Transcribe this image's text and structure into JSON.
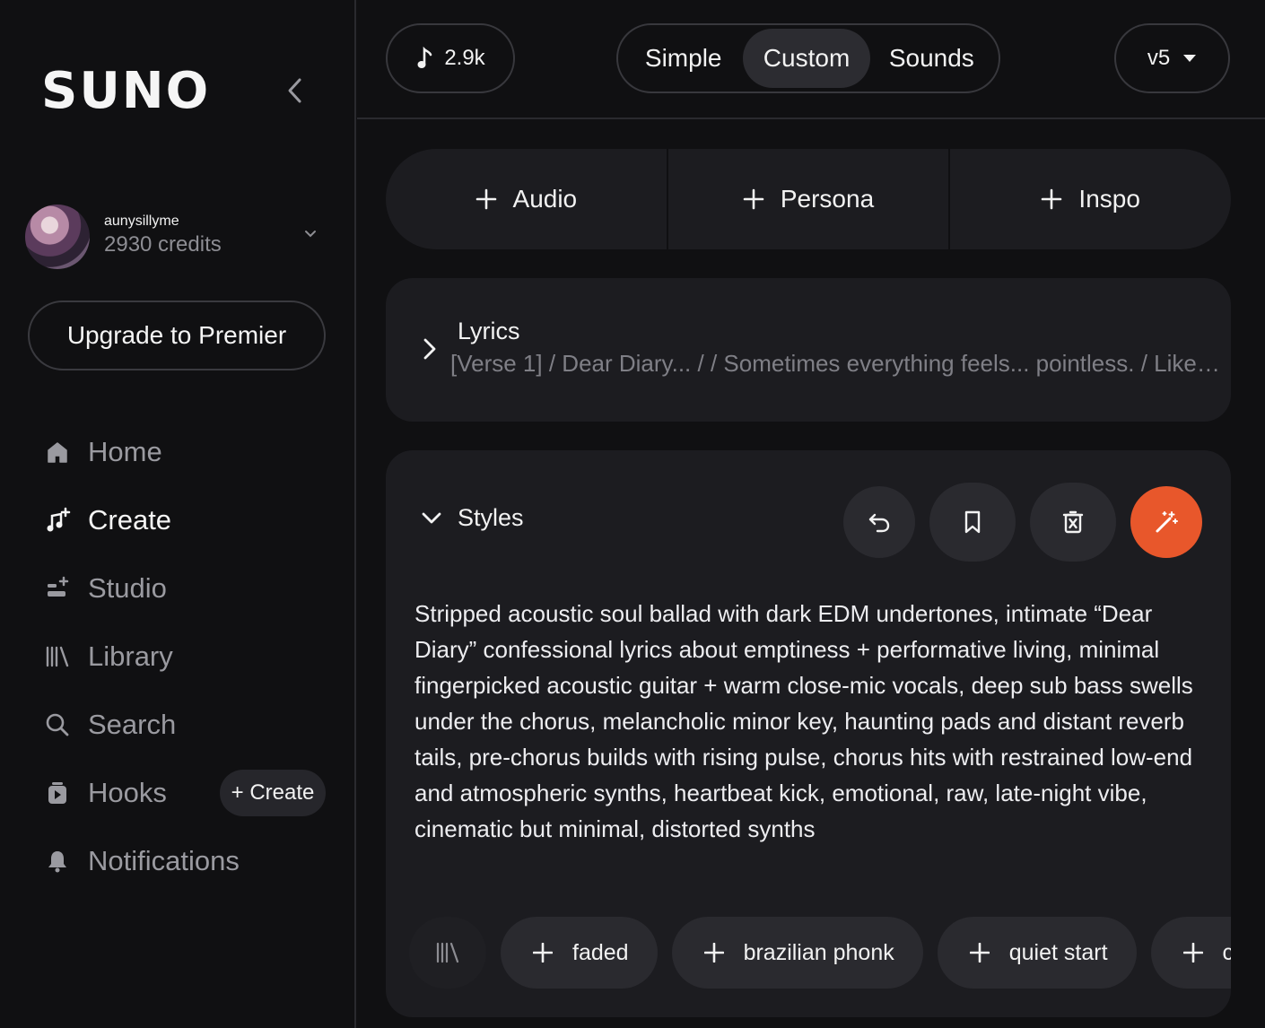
{
  "sidebar": {
    "logo": "SUNO",
    "user": {
      "name": "aunysillyme",
      "credits": "2930 credits"
    },
    "upgrade_label": "Upgrade to Premier",
    "nav": [
      {
        "label": "Home",
        "icon": "home-icon",
        "active": false
      },
      {
        "label": "Create",
        "icon": "create-music-icon",
        "active": true
      },
      {
        "label": "Studio",
        "icon": "studio-icon",
        "active": false
      },
      {
        "label": "Library",
        "icon": "library-icon",
        "active": false
      },
      {
        "label": "Search",
        "icon": "search-icon",
        "active": false
      },
      {
        "label": "Hooks",
        "icon": "hooks-icon",
        "active": false
      },
      {
        "label": "Notifications",
        "icon": "bell-icon",
        "active": false
      }
    ],
    "hooks_create_label": "+ Create"
  },
  "topbar": {
    "credits_label": "2.9k",
    "modes": [
      "Simple",
      "Custom",
      "Sounds"
    ],
    "active_mode": "Custom",
    "version": "v5"
  },
  "add_buttons": [
    "Audio",
    "Persona",
    "Inspo"
  ],
  "lyrics": {
    "title": "Lyrics",
    "preview": "[Verse 1] / Dear Diary... / / Sometimes everything feels... pointless. / Like t..."
  },
  "styles": {
    "title": "Styles",
    "text": "Stripped acoustic soul ballad with dark EDM undertones, intimate “Dear Diary” confessional lyrics about emptiness + performative living, minimal fingerpicked acoustic guitar + warm close-mic vocals, deep sub bass swells under the chorus, melancholic minor key, haunting pads and distant reverb tails, pre-chorus builds with rising pulse, chorus hits with restrained low-end and atmospheric synths, heartbeat kick, emotional, raw, late-night vibe, cinematic but minimal, distorted synths",
    "tags": [
      "faded",
      "brazilian phonk",
      "quiet start",
      "co"
    ]
  },
  "colors": {
    "accent": "#e8572b",
    "background": "#101012",
    "card": "#1c1c20"
  }
}
